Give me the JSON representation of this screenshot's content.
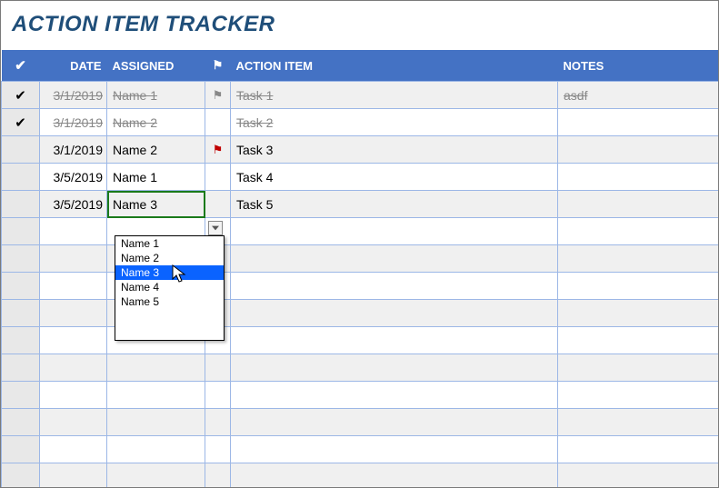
{
  "title": "ACTION ITEM TRACKER",
  "headers": {
    "check": "✔",
    "date": "DATE",
    "assigned": "ASSIGNED",
    "flag": "⚑",
    "action": "ACTION ITEM",
    "notes": "NOTES"
  },
  "rows": [
    {
      "checked": true,
      "date": "3/1/2019",
      "assigned": "Name 1",
      "flag": "gray",
      "action": "Task 1",
      "notes": "asdf",
      "done": true
    },
    {
      "checked": true,
      "date": "3/1/2019",
      "assigned": "Name 2",
      "flag": "",
      "action": "Task 2",
      "notes": "",
      "done": true
    },
    {
      "checked": false,
      "date": "3/1/2019",
      "assigned": "Name 2",
      "flag": "red",
      "action": "Task 3",
      "notes": "",
      "done": false
    },
    {
      "checked": false,
      "date": "3/5/2019",
      "assigned": "Name 1",
      "flag": "",
      "action": "Task 4",
      "notes": "",
      "done": false
    },
    {
      "checked": false,
      "date": "3/5/2019",
      "assigned": "Name 3",
      "flag": "",
      "action": "Task 5",
      "notes": "",
      "done": false,
      "selected": true
    }
  ],
  "empty_rows": 10,
  "dropdown": {
    "options": [
      "Name 1",
      "Name 2",
      "Name 3",
      "Name 4",
      "Name 5"
    ],
    "highlighted": "Name 3"
  }
}
